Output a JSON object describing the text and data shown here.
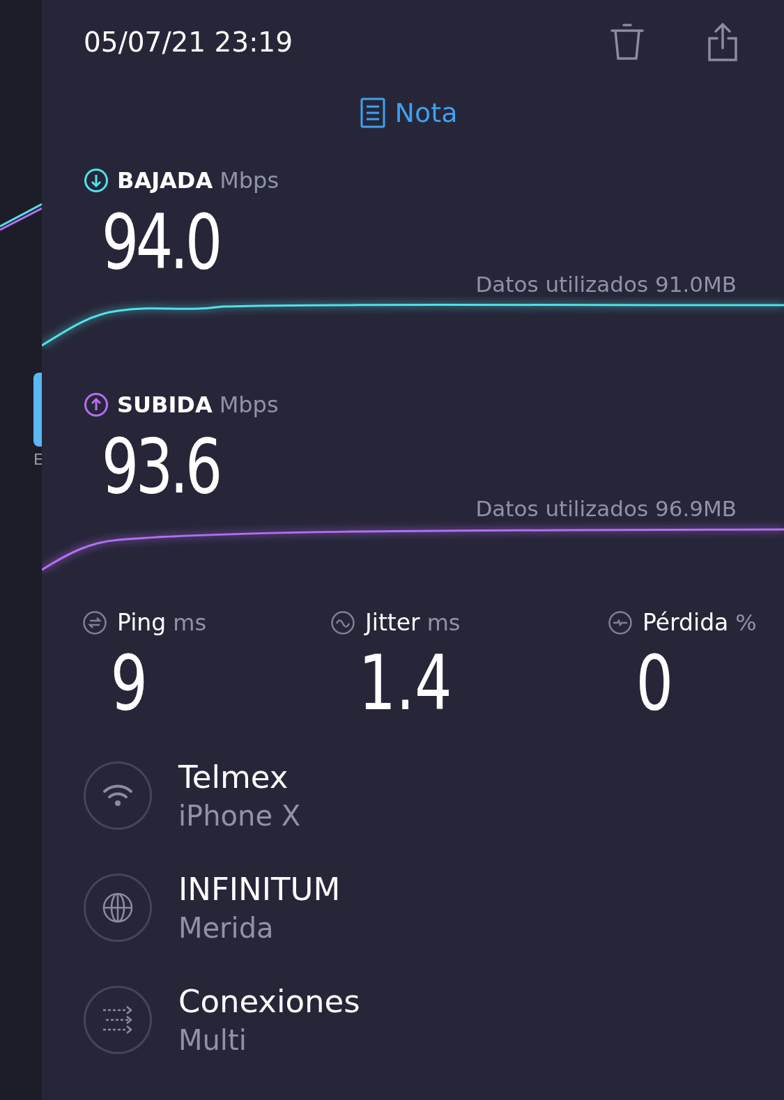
{
  "header": {
    "datetime": "05/07/21 23:19"
  },
  "note": {
    "label": "Nota"
  },
  "speeds": [
    {
      "kind": "download",
      "label": "BAJADA",
      "unit": "Mbps",
      "value": "94.0",
      "data_used": "Datos utilizados 91.0MB",
      "color": "#4fe3e8"
    },
    {
      "kind": "upload",
      "label": "SUBIDA",
      "unit": "Mbps",
      "value": "93.6",
      "data_used": "Datos utilizados 96.9MB",
      "color": "#b56ef2"
    }
  ],
  "metrics": [
    {
      "kind": "ping",
      "label": "Ping",
      "unit": "ms",
      "value": "9"
    },
    {
      "kind": "jitter",
      "label": "Jitter",
      "unit": "ms",
      "value": "1.4"
    },
    {
      "kind": "loss",
      "label": "Pérdida",
      "unit": "%",
      "value": "0"
    }
  ],
  "details": [
    {
      "kind": "wifi",
      "title": "Telmex",
      "subtitle": "iPhone X"
    },
    {
      "kind": "globe",
      "title": "INFINITUM",
      "subtitle": "Merida"
    },
    {
      "kind": "connections",
      "title": "Conexiones",
      "subtitle": "Multi"
    }
  ],
  "background_screen": {
    "letter": "E"
  }
}
